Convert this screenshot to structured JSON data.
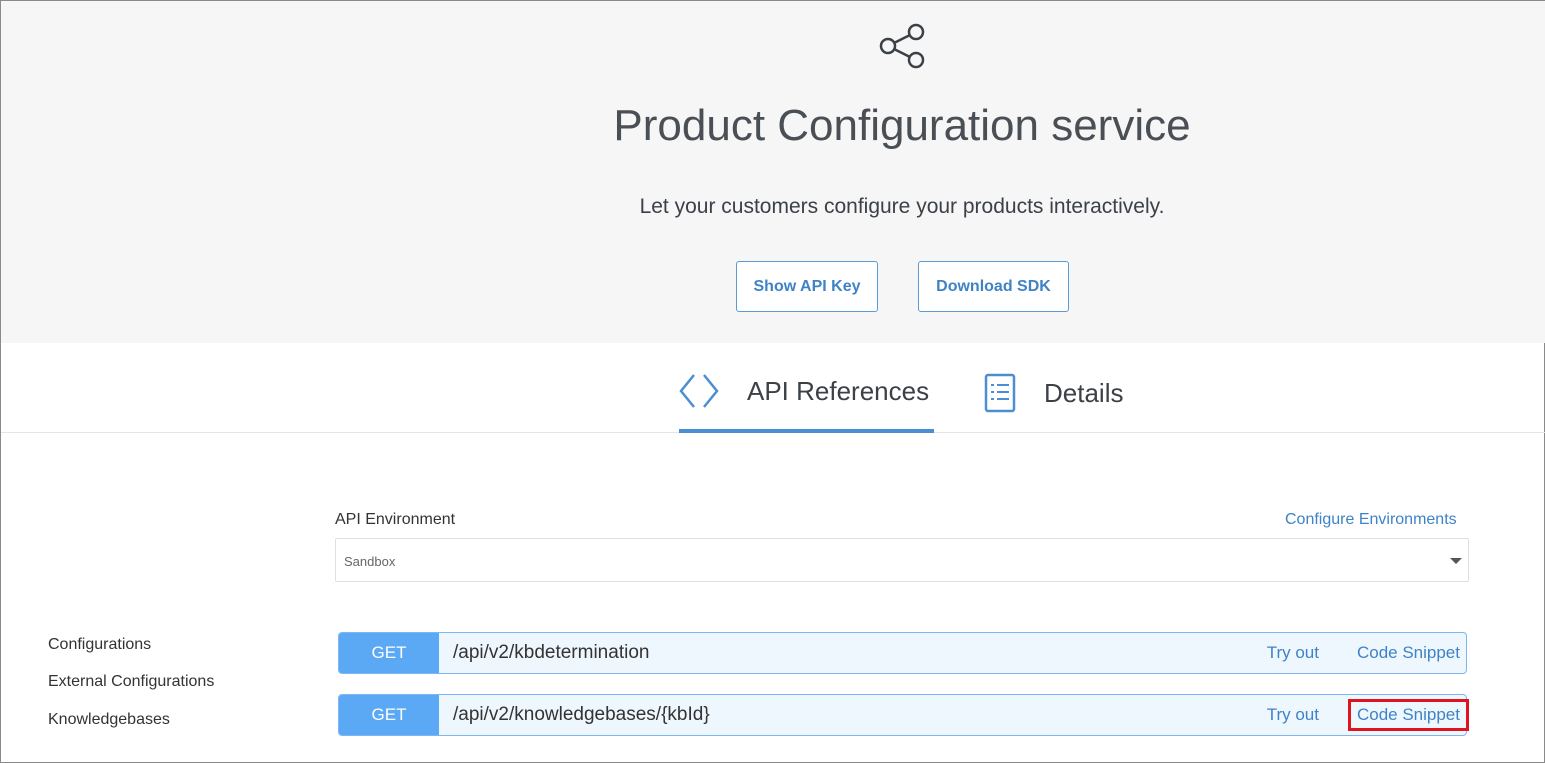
{
  "header": {
    "title": "Product Configuration service",
    "subtitle": "Let your customers configure your products interactively.",
    "show_api_key": "Show API Key",
    "download_sdk": "Download SDK"
  },
  "tabs": [
    {
      "label": "API References",
      "icon": "code-brackets-icon",
      "active": true
    },
    {
      "label": "Details",
      "icon": "document-list-icon",
      "active": false
    }
  ],
  "environment": {
    "label": "API Environment",
    "configure_link": "Configure Environments",
    "value": "Sandbox"
  },
  "sidebar": {
    "items": [
      {
        "label": "Configurations"
      },
      {
        "label": "External Configurations"
      },
      {
        "label": "Knowledgebases",
        "active": true
      }
    ]
  },
  "endpoints": [
    {
      "method": "GET",
      "path": "/api/v2/kbdetermination",
      "try": "Try out",
      "snippet": "Code Snippet"
    },
    {
      "method": "GET",
      "path": "/api/v2/knowledgebases/{kbId}",
      "try": "Try out",
      "snippet": "Code Snippet",
      "highlighted": true
    }
  ],
  "colors": {
    "accent": "#4a8fd4",
    "get_badge": "#5ba9f5",
    "highlight": "#e0141e"
  }
}
